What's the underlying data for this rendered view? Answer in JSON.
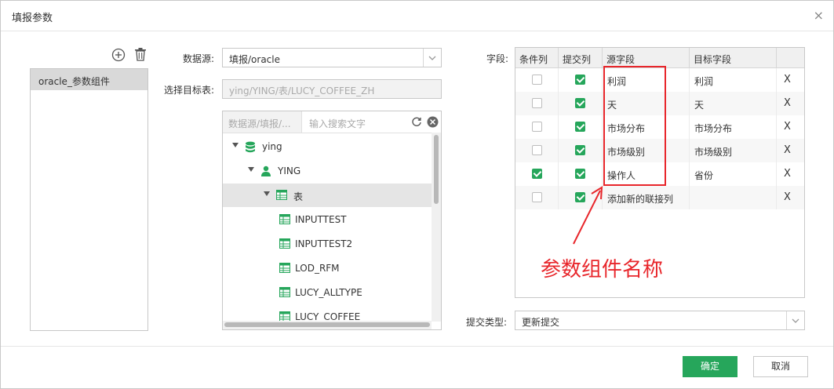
{
  "dialog": {
    "title": "填报参数",
    "close": "×"
  },
  "components": {
    "items": [
      {
        "label": "oracle_参数组件"
      }
    ]
  },
  "datasource": {
    "label": "数据源:",
    "value": "填报/oracle"
  },
  "target_table": {
    "label": "选择目标表:",
    "value": "ying/YING/表/LUCY_COFFEE_ZH"
  },
  "tree": {
    "source_placeholder": "数据源/填报/...",
    "search_placeholder": "输入搜索文字",
    "nodes": [
      {
        "name": "ying",
        "type": "database"
      },
      {
        "name": "YING",
        "type": "user"
      },
      {
        "name": "表",
        "type": "folder"
      },
      {
        "name": "INPUTTEST",
        "type": "table"
      },
      {
        "name": "INPUTTEST2",
        "type": "table"
      },
      {
        "name": "LOD_RFM",
        "type": "table"
      },
      {
        "name": "LUCY_ALLTYPE",
        "type": "table"
      },
      {
        "name": "LUCY_COFFEE",
        "type": "table"
      }
    ]
  },
  "fields": {
    "label": "字段:",
    "headers": {
      "condition": "条件列",
      "submit": "提交列",
      "source": "源字段",
      "target": "目标字段"
    },
    "rows": [
      {
        "condition": false,
        "submit": true,
        "source": "利润",
        "target": "利润",
        "delete": "X"
      },
      {
        "condition": false,
        "submit": true,
        "source": "天",
        "target": "天",
        "delete": "X"
      },
      {
        "condition": false,
        "submit": true,
        "source": "市场分布",
        "target": "市场分布",
        "delete": "X"
      },
      {
        "condition": false,
        "submit": true,
        "source": "市场级别",
        "target": "市场级别",
        "delete": "X"
      },
      {
        "condition": true,
        "submit": true,
        "source": "操作人",
        "target": "省份",
        "delete": "X"
      },
      {
        "condition": false,
        "submit": true,
        "source": "添加新的联接列",
        "target": "",
        "delete": "X"
      }
    ]
  },
  "annotation": {
    "text": "参数组件名称",
    "color": "#e8262b"
  },
  "submit_type": {
    "label": "提交类型:",
    "value": "更新提交"
  },
  "buttons": {
    "ok": "确定",
    "cancel": "取消"
  },
  "colors": {
    "accent": "#26a65b",
    "annotation": "#e8262b"
  }
}
